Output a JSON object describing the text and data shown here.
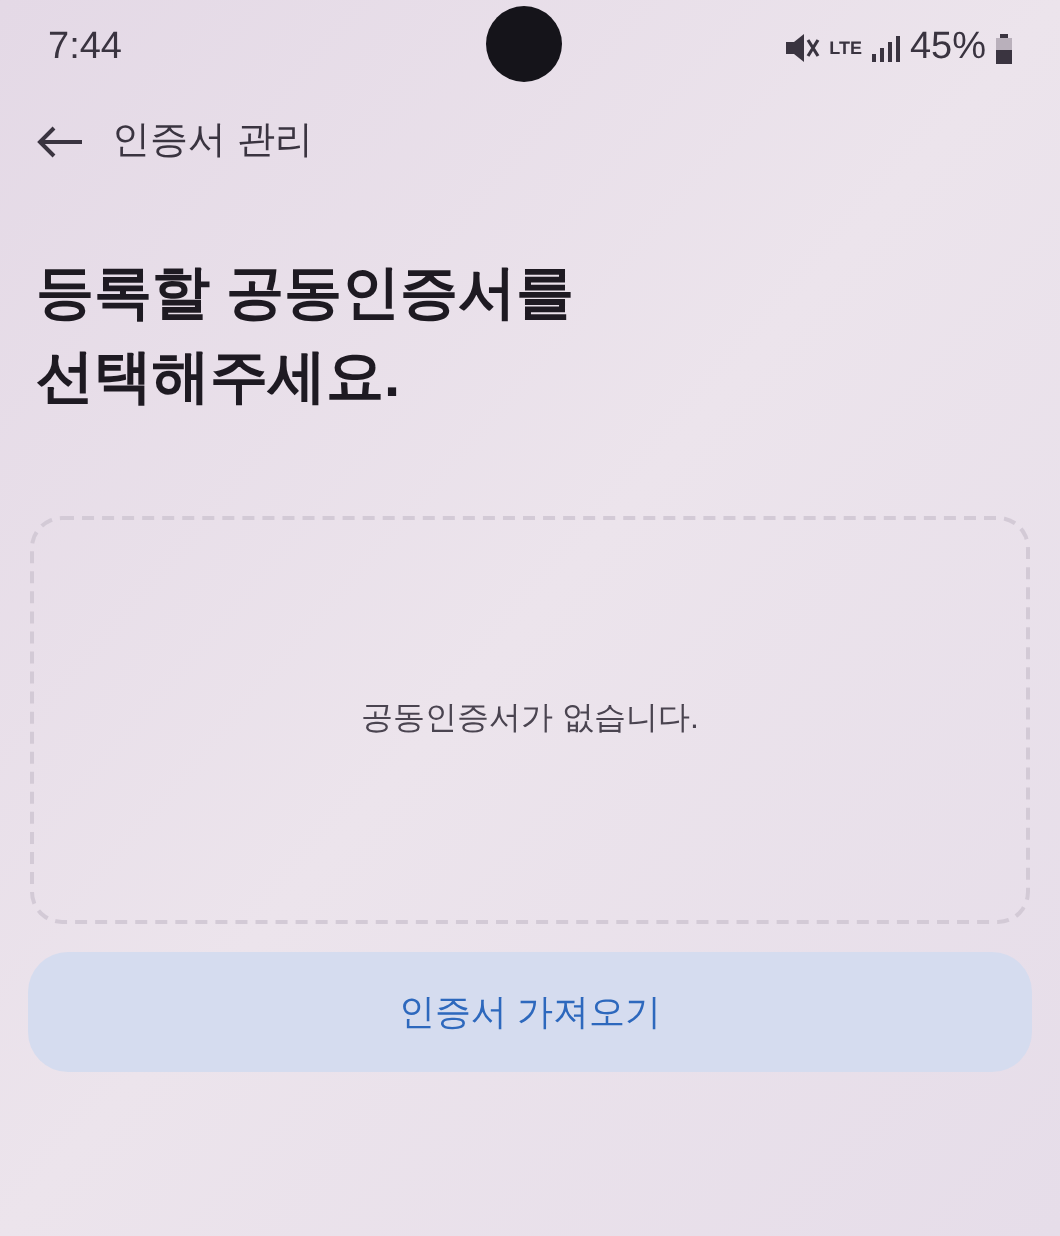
{
  "status_bar": {
    "time": "7:44",
    "network": "LTE",
    "battery": "45%"
  },
  "header": {
    "title": "인증서 관리"
  },
  "heading": [
    "등록할 공동인증서를",
    "선택해주세요."
  ],
  "empty_list": {
    "message": "공동인증서가 없습니다."
  },
  "buttons": [
    {
      "label": "인증서 가져오기"
    }
  ]
}
